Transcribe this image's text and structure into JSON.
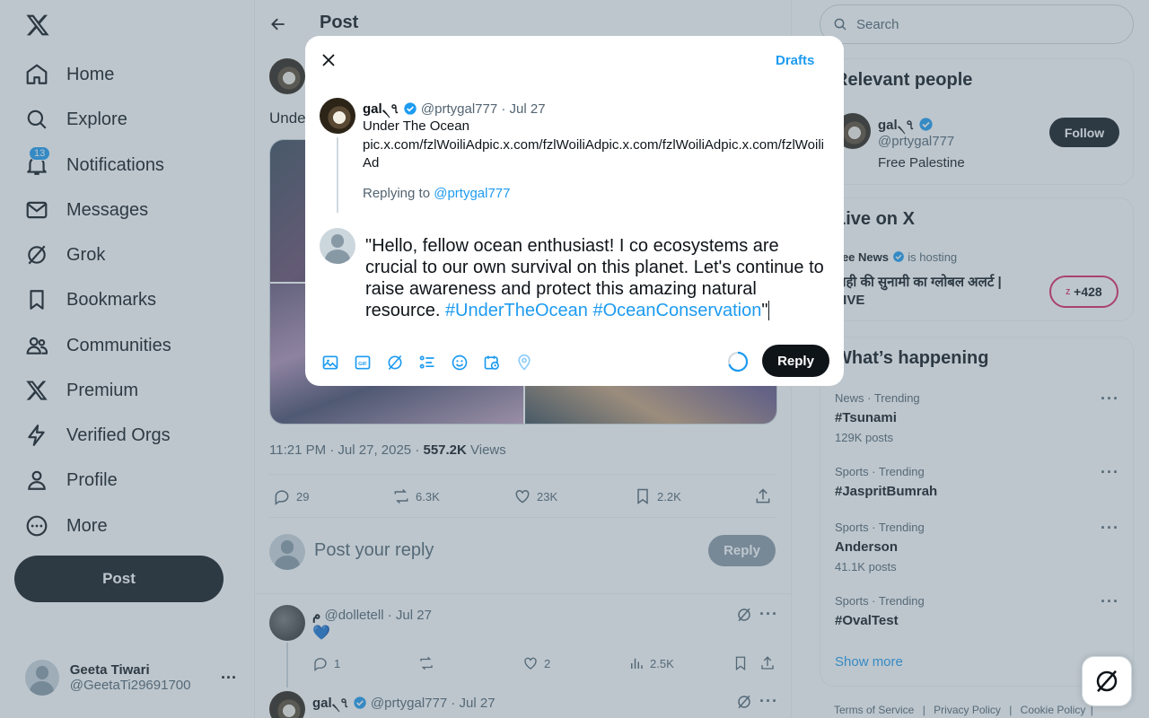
{
  "nav": {
    "items": [
      {
        "label": "Home",
        "icon": "home-icon"
      },
      {
        "label": "Explore",
        "icon": "search-icon"
      },
      {
        "label": "Notifications",
        "icon": "bell-icon",
        "badge": "13"
      },
      {
        "label": "Messages",
        "icon": "envelope-icon"
      },
      {
        "label": "Grok",
        "icon": "grok-icon"
      },
      {
        "label": "Bookmarks",
        "icon": "bookmark-icon"
      },
      {
        "label": "Communities",
        "icon": "communities-icon"
      },
      {
        "label": "Premium",
        "icon": "x-icon"
      },
      {
        "label": "Verified Orgs",
        "icon": "lightning-icon"
      },
      {
        "label": "Profile",
        "icon": "person-icon"
      },
      {
        "label": "More",
        "icon": "more-circle-icon"
      }
    ],
    "post_button": "Post",
    "account": {
      "name": "Geeta Tiwari",
      "handle": "@GeetaTi29691700"
    }
  },
  "main": {
    "title": "Post",
    "tweet_text_partial": "Unde",
    "timestamp": "11:21 PM · Jul 27, 2025 · ",
    "views_count": "557.2K",
    "views_label": " Views",
    "actions": {
      "replies": "29",
      "reposts": "6.3K",
      "likes": "23K",
      "bookmarks": "2.2K"
    },
    "reply_placeholder": "Post your reply",
    "reply_button": "Reply",
    "replies": [
      {
        "name": "م",
        "handle": "@dolletell · Jul 27",
        "content": "💙",
        "replies": "1",
        "likes": "2",
        "views": "2.5K"
      },
      {
        "name": "gal৲৭",
        "handle": "@prtygal777 · Jul 27"
      }
    ]
  },
  "right": {
    "search_placeholder": "Search",
    "relevant": {
      "heading": "Relevant people",
      "name": "gal৲৭",
      "handle": "@prtygal777",
      "bio": "Free Palestine",
      "follow": "Follow"
    },
    "live": {
      "heading": "Live on X",
      "host": "Zee News",
      "hosting": "is hosting",
      "title": "बाही की सुनामी का ग्लोबल अलर्ट | LIVE",
      "count": "+428"
    },
    "happening": {
      "heading": "What’s happening",
      "trends": [
        {
          "meta": "News · Trending",
          "title": "#Tsunami",
          "posts": "129K posts"
        },
        {
          "meta": "Sports · Trending",
          "title": "#JaspritBumrah",
          "posts": ""
        },
        {
          "meta": "Sports · Trending",
          "title": "Anderson",
          "posts": "41.1K posts"
        },
        {
          "meta": "Sports · Trending",
          "title": "#OvalTest",
          "posts": ""
        }
      ],
      "show_more": "Show more"
    },
    "footer": [
      "Terms of Service",
      "Privacy Policy",
      "Cookie Policy"
    ]
  },
  "modal": {
    "drafts": "Drafts",
    "original": {
      "name": "gal৲৭",
      "meta": "@prtygal777 · Jul 27",
      "title": "Under The Ocean",
      "link": "pic.x.com/fzlWoiliAdpic.x.com/fzlWoiliAdpic.x.com/fzlWoiliAdpic.x.com/fzlWoiliAd",
      "replying_prefix": "Replying to ",
      "replying_handle": "@prtygal777"
    },
    "reply_text": "\"Hello, fellow ocean enthusiast! I co ecosystems are crucial to our own survival on this planet. Let's continue to raise awareness and protect this amazing natural resource. ",
    "reply_hashtags": "#UnderTheOcean #OceanConservation",
    "reply_end": "\"",
    "reply_button": "Reply",
    "tools": [
      "image-icon",
      "gif-icon",
      "grok-icon",
      "poll-icon",
      "emoji-icon",
      "schedule-icon",
      "location-icon"
    ],
    "accent_color": "#1d9bf0"
  }
}
